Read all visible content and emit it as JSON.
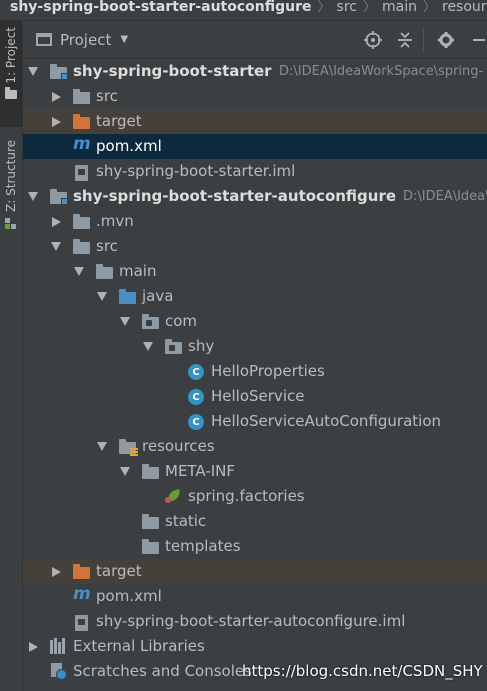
{
  "breadcrumb": [
    {
      "label": "shy-spring-boot-starter-autoconfigure"
    },
    {
      "label": "src"
    },
    {
      "label": "main"
    },
    {
      "label": "resources"
    }
  ],
  "tool_strip": {
    "project_tab": "1: Project",
    "structure_tab": "Z: Structure"
  },
  "panel": {
    "title": "Project",
    "caret_icon": "chevron-down-icon",
    "buttons": [
      "locate-icon",
      "collapse-all-icon",
      "settings-icon",
      "hide-icon"
    ]
  },
  "tree": [
    {
      "label": "shy-spring-boot-starter",
      "path": "D:\\IDEA\\IdeaWorkSpace\\spring-",
      "bold": true,
      "icon": "module-folder-icon",
      "expanded": true,
      "arrow": true
    },
    {
      "label": "src",
      "icon": "folder-icon",
      "expanded": false,
      "arrow": true
    },
    {
      "label": "target",
      "icon": "excluded-folder-icon",
      "expanded": false,
      "arrow": true,
      "state": "excluded"
    },
    {
      "label": "pom.xml",
      "icon": "maven-icon",
      "state": "selected"
    },
    {
      "label": "shy-spring-boot-starter.iml",
      "icon": "iml-file-icon"
    },
    {
      "label": "shy-spring-boot-starter-autoconfigure",
      "path": "D:\\IDEA\\IdeaWo",
      "bold": true,
      "icon": "module-folder-icon",
      "expanded": true,
      "arrow": true
    },
    {
      "label": ".mvn",
      "icon": "folder-icon",
      "expanded": false,
      "arrow": true
    },
    {
      "label": "src",
      "icon": "folder-icon",
      "expanded": true,
      "arrow": true
    },
    {
      "label": "main",
      "icon": "folder-icon",
      "expanded": true,
      "arrow": true
    },
    {
      "label": "java",
      "icon": "source-root-icon",
      "expanded": true,
      "arrow": true
    },
    {
      "label": "com",
      "icon": "package-icon",
      "expanded": true,
      "arrow": true
    },
    {
      "label": "shy",
      "icon": "package-icon",
      "expanded": true,
      "arrow": true
    },
    {
      "label": "HelloProperties",
      "icon": "class-icon",
      "badge": "C"
    },
    {
      "label": "HelloService",
      "icon": "class-icon",
      "badge": "C"
    },
    {
      "label": "HelloServiceAutoConfiguration",
      "icon": "class-icon",
      "badge": "C"
    },
    {
      "label": "resources",
      "icon": "resources-root-icon",
      "expanded": true,
      "arrow": true
    },
    {
      "label": "META-INF",
      "icon": "folder-icon",
      "expanded": true,
      "arrow": true
    },
    {
      "label": "spring.factories",
      "icon": "spring-leaf-icon"
    },
    {
      "label": "static",
      "icon": "folder-icon"
    },
    {
      "label": "templates",
      "icon": "folder-icon"
    },
    {
      "label": "target",
      "icon": "excluded-folder-icon",
      "expanded": false,
      "arrow": true,
      "state": "excluded"
    },
    {
      "label": "pom.xml",
      "icon": "maven-icon"
    },
    {
      "label": "shy-spring-boot-starter-autoconfigure.iml",
      "icon": "iml-file-icon"
    },
    {
      "label": "External Libraries",
      "icon": "libraries-icon",
      "expanded": false,
      "arrow": true
    },
    {
      "label": "Scratches and Consoles",
      "icon": "scratches-icon"
    }
  ],
  "watermark": "https://blog.csdn.net/CSDN_SHY",
  "colors": {
    "background": "#3c3f41",
    "selection": "#0d293e",
    "excluded_row": "#45413a",
    "excluded_folder": "#d0763a",
    "source_root": "#4a8ec6",
    "class_badge": "#3592c4"
  }
}
